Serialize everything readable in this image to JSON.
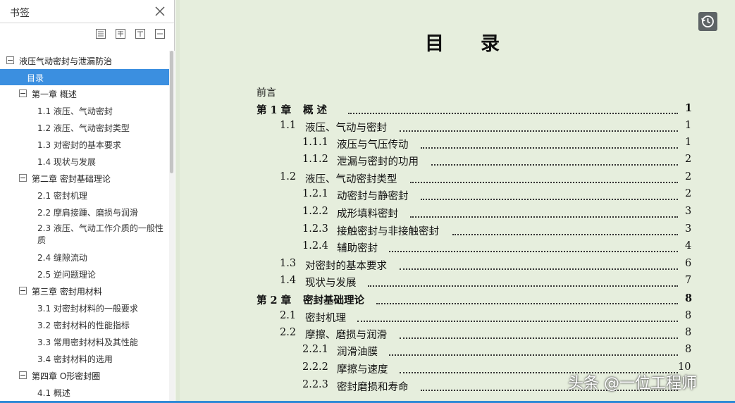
{
  "sidebar": {
    "title": "书签",
    "tools": [
      "collapse-all-icon",
      "expand-all-icon",
      "expand-current-icon",
      "bookmark-add-icon"
    ],
    "items": [
      {
        "label": "液压气动密封与泄漏防治",
        "level": 0,
        "toggle": true
      },
      {
        "label": "目录",
        "level": 1,
        "selected": true
      },
      {
        "label": "第一章  概述",
        "level": 1,
        "toggle": true
      },
      {
        "label": "1.1  液压、气动密封",
        "level": 2
      },
      {
        "label": "1.2  液压、气动密封类型",
        "level": 2
      },
      {
        "label": "1.3  对密封的基本要求",
        "level": 2
      },
      {
        "label": "1.4  现状与发展",
        "level": 2
      },
      {
        "label": "第二章  密封基础理论",
        "level": 1,
        "toggle": true
      },
      {
        "label": "2.1  密封机理",
        "level": 2
      },
      {
        "label": "2.2  摩肩接踵、磨损与润滑",
        "level": 2
      },
      {
        "label": "2.3  液压、气动工作介质的一般性质",
        "level": 2,
        "wrap": true
      },
      {
        "label": "2.4  缝隙流动",
        "level": 2
      },
      {
        "label": "2.5  逆问题理论",
        "level": 2
      },
      {
        "label": "第三章  密封用材料",
        "level": 1,
        "toggle": true
      },
      {
        "label": "3.1  对密封材料的一般要求",
        "level": 2
      },
      {
        "label": "3.2  密封材料的性能指标",
        "level": 2
      },
      {
        "label": "3.3  常用密封材料及其性能",
        "level": 2
      },
      {
        "label": "3.4  密封材料的选用",
        "level": 2
      },
      {
        "label": "第四章  O形密封圈",
        "level": 1,
        "toggle": true
      },
      {
        "label": "4.1  概述",
        "level": 2
      }
    ]
  },
  "document": {
    "title": "目录",
    "preface": "前言",
    "toc": [
      {
        "num": "第 1 章",
        "title": "概    述",
        "page": "1",
        "level": 0
      },
      {
        "num": "1.1",
        "title": "液压、气动与密封",
        "page": "1",
        "level": 1
      },
      {
        "num": "1.1.1",
        "title": "液压与气压传动",
        "page": "1",
        "level": 2
      },
      {
        "num": "1.1.2",
        "title": "泄漏与密封的功用",
        "page": "2",
        "level": 2
      },
      {
        "num": "1.2",
        "title": "液压、气动密封类型",
        "page": "2",
        "level": 1
      },
      {
        "num": "1.2.1",
        "title": "动密封与静密封",
        "page": "2",
        "level": 2
      },
      {
        "num": "1.2.2",
        "title": "成形填料密封",
        "page": "3",
        "level": 2
      },
      {
        "num": "1.2.3",
        "title": "接触密封与非接触密封",
        "page": "3",
        "level": 2
      },
      {
        "num": "1.2.4",
        "title": "辅助密封",
        "page": "4",
        "level": 2
      },
      {
        "num": "1.3",
        "title": "对密封的基本要求",
        "page": "6",
        "level": 1
      },
      {
        "num": "1.4",
        "title": "现状与发展",
        "page": "7",
        "level": 1
      },
      {
        "num": "第 2 章",
        "title": "密封基础理论",
        "page": "8",
        "level": 0
      },
      {
        "num": "2.1",
        "title": "密封机理",
        "page": "8",
        "level": 1
      },
      {
        "num": "2.2",
        "title": "摩擦、磨损与润滑",
        "page": "8",
        "level": 1
      },
      {
        "num": "2.2.1",
        "title": "润滑油膜",
        "page": "8",
        "level": 2
      },
      {
        "num": "2.2.2",
        "title": "摩擦与速度",
        "page": "10",
        "level": 2
      },
      {
        "num": "2.2.3",
        "title": "密封磨损和寿命",
        "page": "",
        "level": 2
      }
    ],
    "watermark": "头条 @一位工程师"
  },
  "colors": {
    "page_background": "#e6eedd",
    "selection": "#3b8fe0",
    "status_bar": "#2f8ad6"
  }
}
